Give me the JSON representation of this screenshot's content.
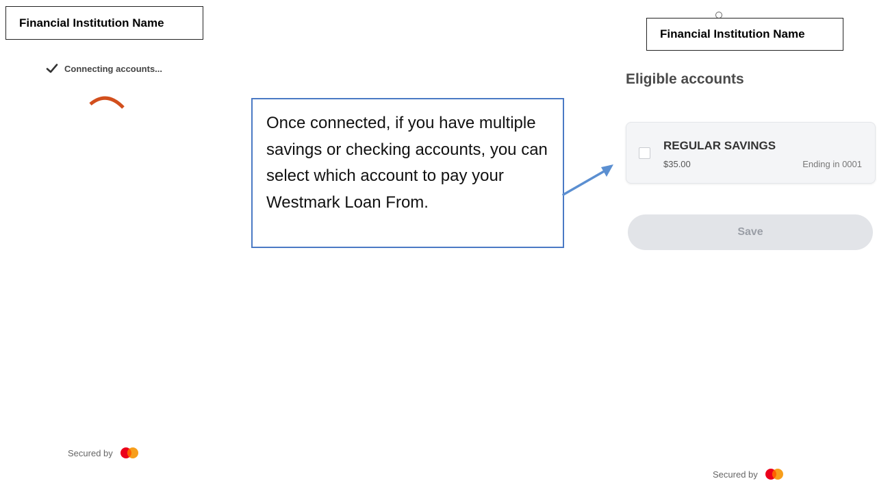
{
  "left_panel": {
    "institution_name": "Financial Institution Name",
    "status_text": "Connecting accounts...",
    "secured_by": "Secured by"
  },
  "callout": {
    "text": "Once connected, if you have multiple savings or checking accounts, you can select which account to pay your Westmark Loan From."
  },
  "right_panel": {
    "institution_name": "Financial Institution Name",
    "heading": "Eligible accounts",
    "accounts": [
      {
        "name": "REGULAR SAVINGS",
        "balance": "$35.00",
        "ending": "Ending in 0001"
      }
    ],
    "save_label": "Save",
    "secured_by": "Secured by"
  },
  "colors": {
    "spinner": "#d24f1d",
    "callout_border": "#4a79c4",
    "arrow": "#5b8fd1",
    "mastercard_red": "#eb001b",
    "mastercard_orange": "#f79e1b",
    "save_disabled_bg": "#e2e4e8"
  },
  "icons": {
    "status": "check-icon",
    "loading": "spinner-icon",
    "brand": "mastercard-logo-icon",
    "pointer": "arrow-icon"
  }
}
